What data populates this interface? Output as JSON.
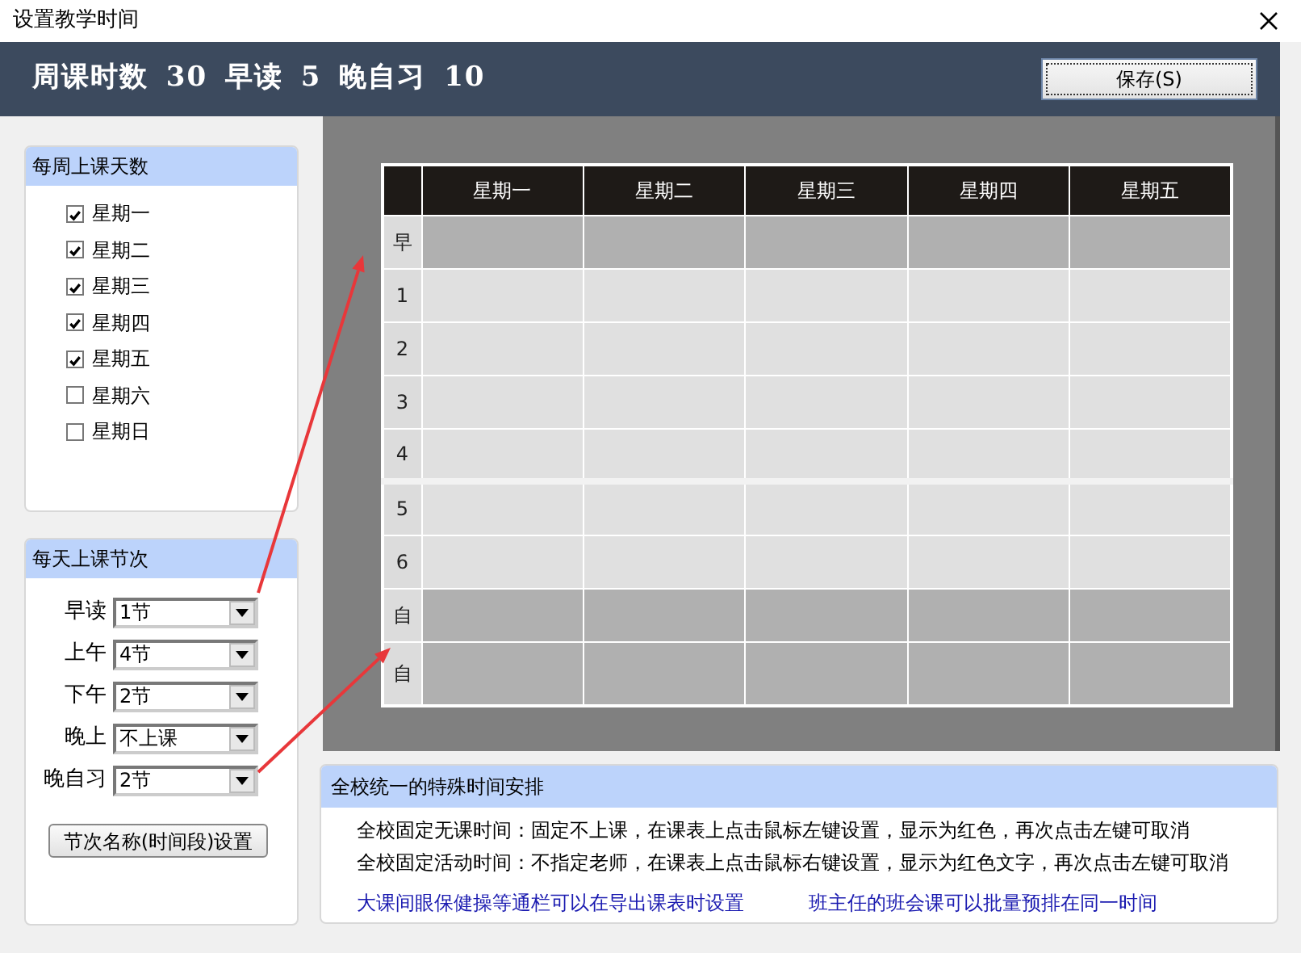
{
  "window": {
    "title": "设置教学时间"
  },
  "header": {
    "summary": "周课时数 30 早读 5 晚自习 10",
    "save_button": "保存(S)"
  },
  "weekdays": {
    "title": "每周上课天数",
    "items": [
      {
        "label": "星期一",
        "checked": true
      },
      {
        "label": "星期二",
        "checked": true
      },
      {
        "label": "星期三",
        "checked": true
      },
      {
        "label": "星期四",
        "checked": true
      },
      {
        "label": "星期五",
        "checked": true
      },
      {
        "label": "星期六",
        "checked": false
      },
      {
        "label": "星期日",
        "checked": false
      }
    ]
  },
  "periods": {
    "title": "每天上课节次",
    "items": [
      {
        "label": "早读",
        "value": "1节"
      },
      {
        "label": "上午",
        "value": "4节"
      },
      {
        "label": "下午",
        "value": "2节"
      },
      {
        "label": "晚上",
        "value": "不上课"
      },
      {
        "label": "晚自习",
        "value": "2节"
      }
    ],
    "button": "节次名称(时间段)设置"
  },
  "timetable": {
    "columns": [
      "星期一",
      "星期二",
      "星期三",
      "星期四",
      "星期五"
    ],
    "rows": [
      {
        "label": "早",
        "kind": "early"
      },
      {
        "label": "1",
        "kind": "day"
      },
      {
        "label": "2",
        "kind": "day"
      },
      {
        "label": "3",
        "kind": "day"
      },
      {
        "label": "4",
        "kind": "day"
      },
      {
        "label": "5",
        "kind": "day"
      },
      {
        "label": "6",
        "kind": "day"
      },
      {
        "label": "自",
        "kind": "evening"
      },
      {
        "label": "自",
        "kind": "evening"
      }
    ]
  },
  "special": {
    "title": "全校统一的特殊时间安排",
    "lines": [
      "全校固定无课时间：固定不上课，在课表上点击鼠标左键设置，显示为红色，再次点击左键可取消",
      "全校固定活动时间：不指定老师，在课表上点击鼠标右键设置，显示为红色文字，再次点击左键可取消"
    ],
    "links": [
      "大课间眼保健操等通栏可以在导出课表时设置",
      "班主任的班会课可以批量预排在同一时间"
    ]
  }
}
